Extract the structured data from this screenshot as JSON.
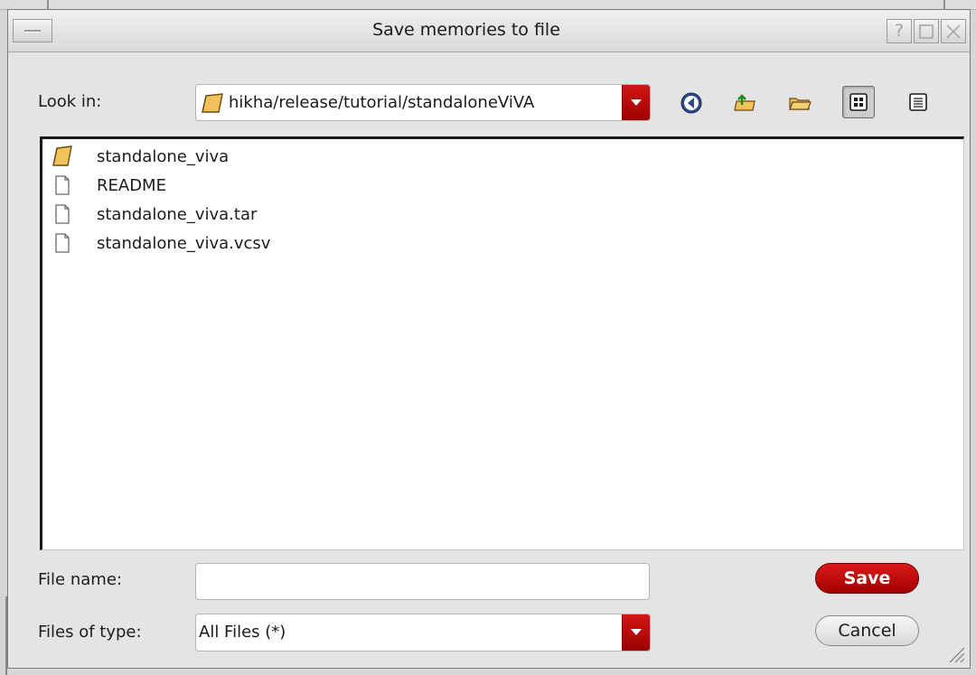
{
  "window": {
    "title": "Save memories to file",
    "help_glyph": "?",
    "maximize_glyph": "□",
    "close_glyph": "X"
  },
  "look_in": {
    "label": "Look in:",
    "value": "hikha/release/tutorial/standaloneViVA"
  },
  "toolbar": {
    "icons": [
      "back-icon",
      "up-folder-icon",
      "new-folder-icon",
      "list-view-icon",
      "detail-view-icon"
    ]
  },
  "files": [
    {
      "name": "standalone_viva",
      "type": "folder"
    },
    {
      "name": "README",
      "type": "file"
    },
    {
      "name": "standalone_viva.tar",
      "type": "file"
    },
    {
      "name": "standalone_viva.vcsv",
      "type": "file"
    }
  ],
  "file_name": {
    "label": "File name:",
    "value": "",
    "placeholder": ""
  },
  "file_type": {
    "label": "Files of type:",
    "value": "All Files (*)"
  },
  "buttons": {
    "save": "Save",
    "cancel": "Cancel"
  },
  "colors": {
    "accent_red": "#c20a0a",
    "dialog_bg": "#e4e4e4",
    "list_bg": "#ffffff"
  }
}
